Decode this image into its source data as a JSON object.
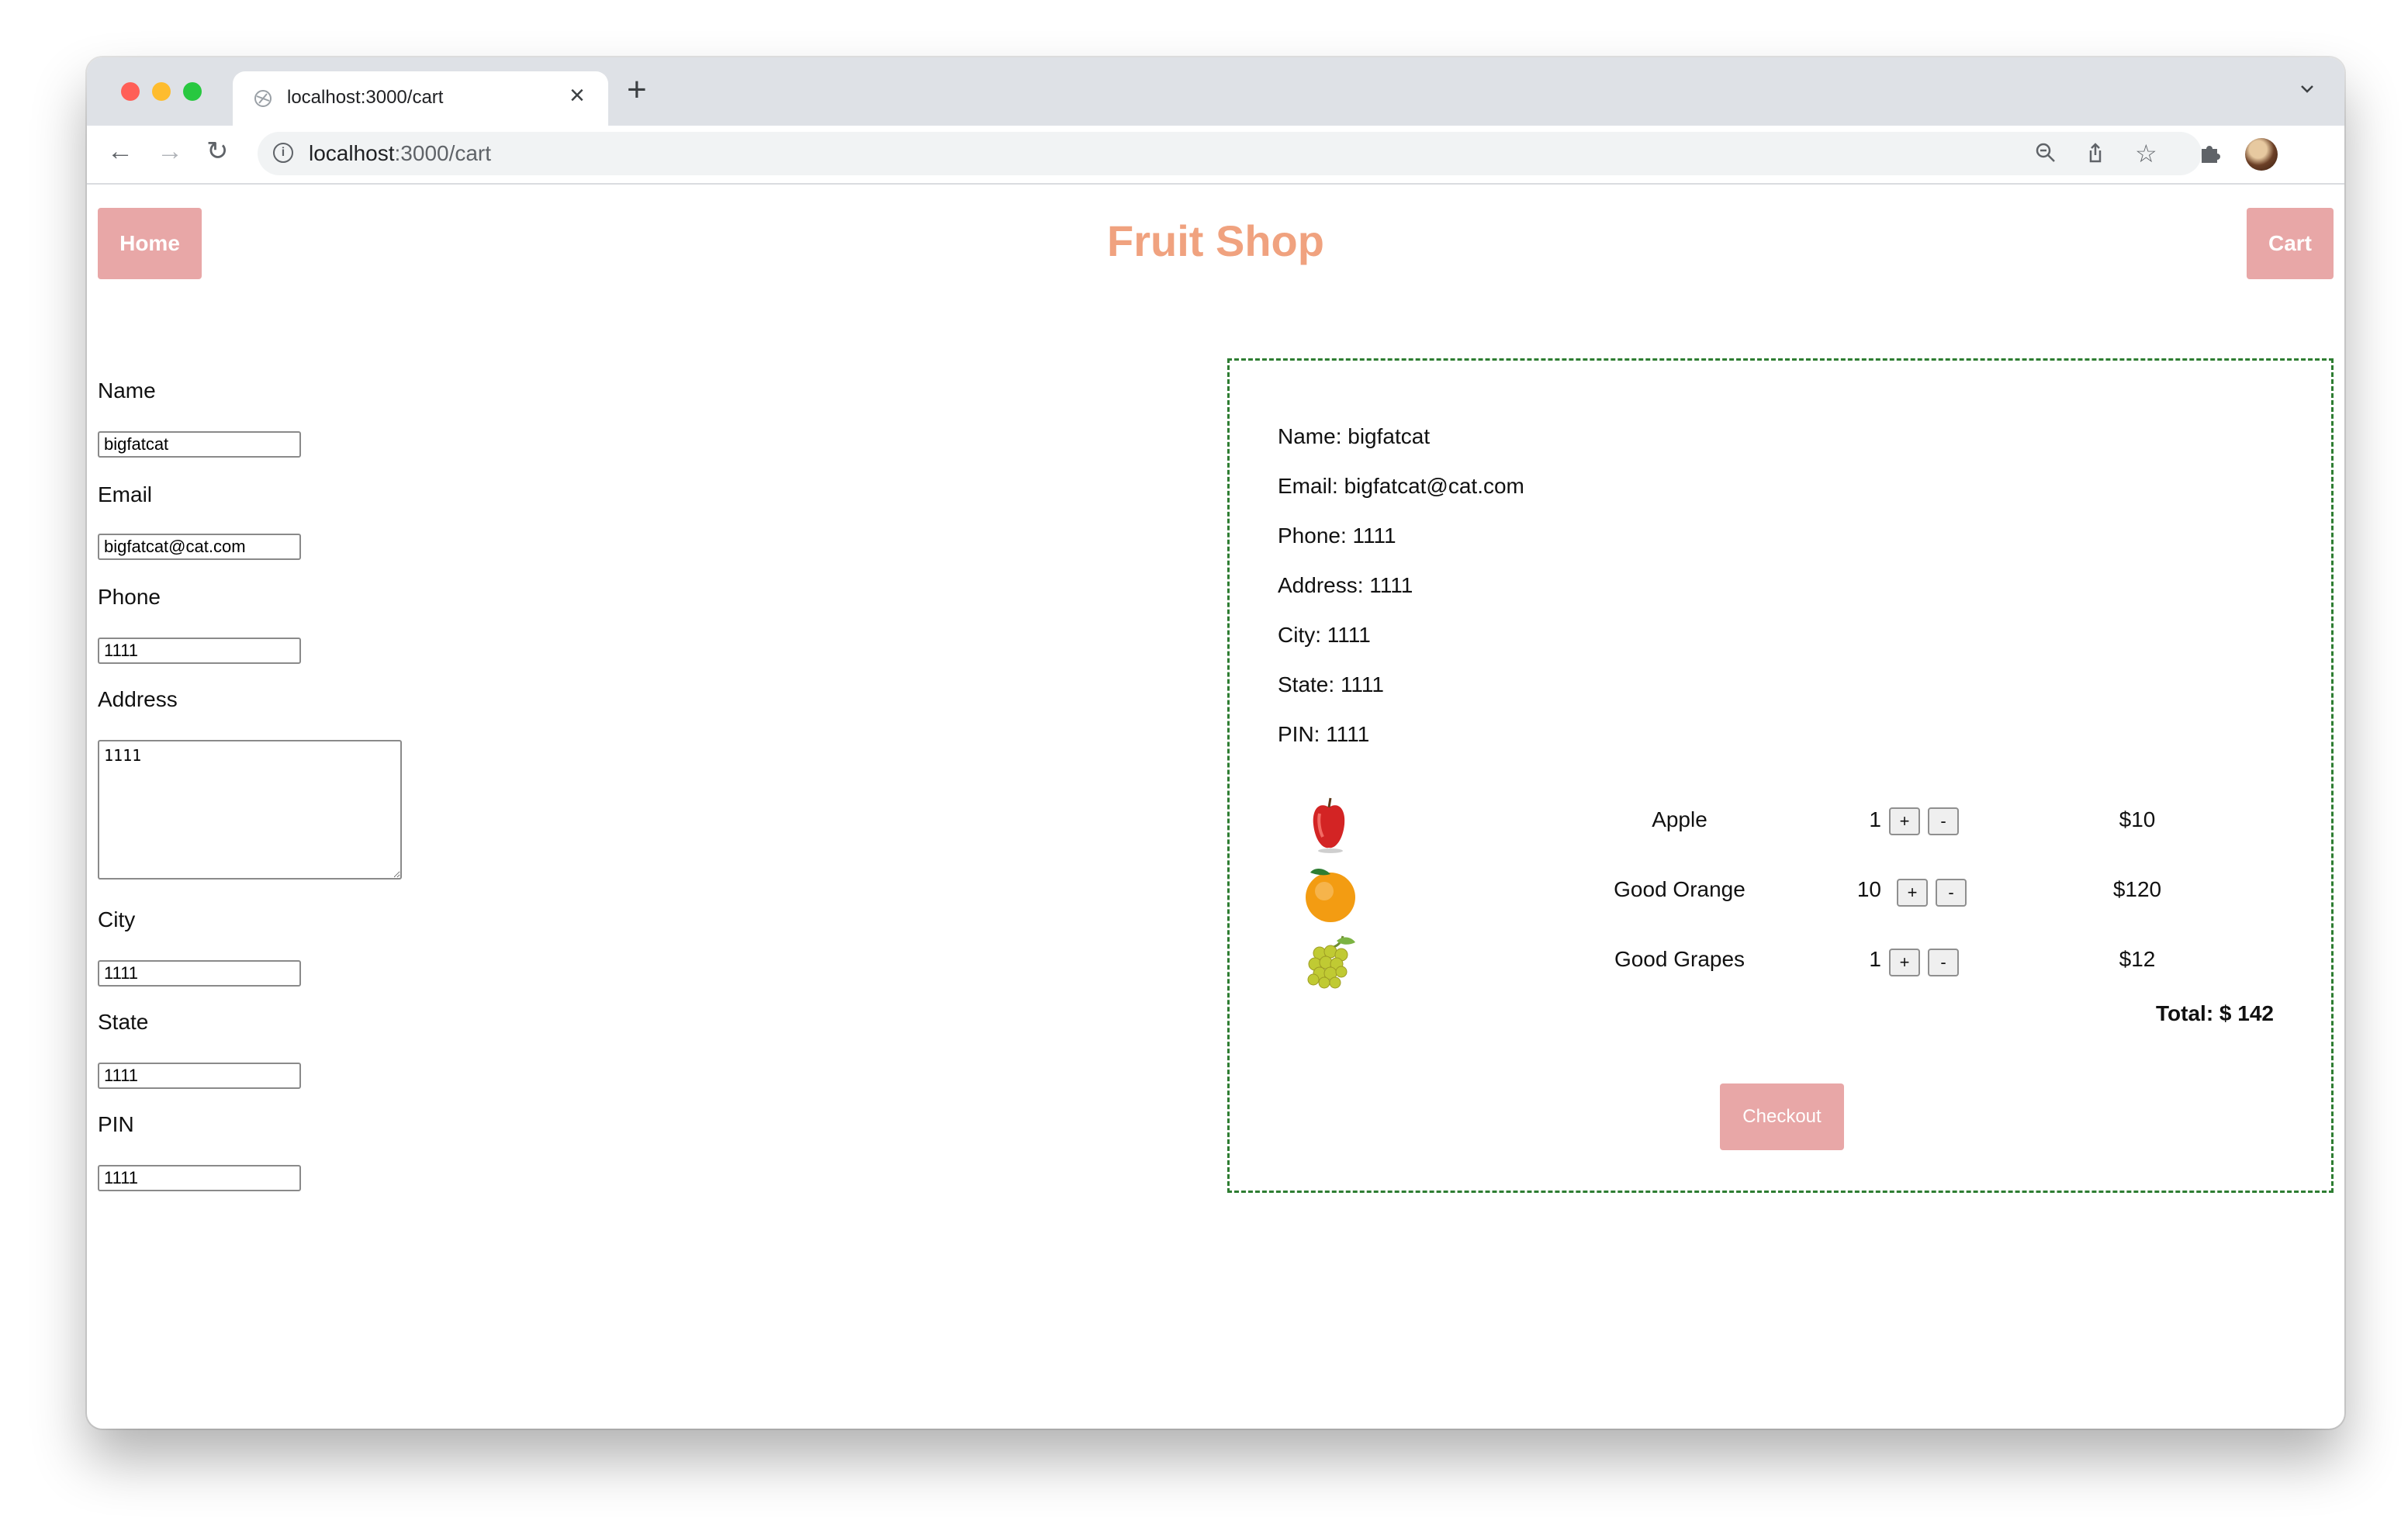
{
  "browser": {
    "tab_title": "localhost:3000/cart",
    "url_host": "localhost",
    "url_path": ":3000/cart",
    "icons": [
      "back-icon",
      "forward-icon",
      "reload-icon",
      "info-icon",
      "zoom-icon",
      "share-icon",
      "star-icon",
      "extensions-icon",
      "profile-avatar",
      "more-icon",
      "tab-list-icon",
      "new-tab-icon",
      "close-icon"
    ]
  },
  "header": {
    "home_label": "Home",
    "title": "Fruit Shop",
    "cart_label": "Cart"
  },
  "form": {
    "name_label": "Name",
    "name_value": "bigfatcat",
    "email_label": "Email",
    "email_value": "bigfatcat@cat.com",
    "phone_label": "Phone",
    "phone_value": "1111",
    "address_label": "Address",
    "address_value": "1111",
    "city_label": "City",
    "city_value": "1111",
    "state_label": "State",
    "state_value": "1111",
    "pin_label": "PIN",
    "pin_value": "1111"
  },
  "summary": {
    "name": "Name: bigfatcat",
    "email": "Email: bigfatcat@cat.com",
    "phone": "Phone: 1111",
    "address": "Address: 1111",
    "city": "City: 1111",
    "state": "State: 1111",
    "pin": "PIN: 1111",
    "items": [
      {
        "name": "Apple",
        "qty": "1",
        "price": "$10",
        "icon": "apple-image"
      },
      {
        "name": "Good Orange",
        "qty": "10",
        "price": "$120",
        "icon": "orange-image"
      },
      {
        "name": "Good Grapes",
        "qty": "1",
        "price": "$12",
        "icon": "grapes-image"
      }
    ],
    "plus_label": "+",
    "minus_label": "-",
    "total": "Total: $ 142",
    "checkout_label": "Checkout"
  },
  "colors": {
    "button_pink": "#e8a7a7",
    "title_orange": "#f0a27f",
    "dashed_border_green": "#2e7d32"
  }
}
